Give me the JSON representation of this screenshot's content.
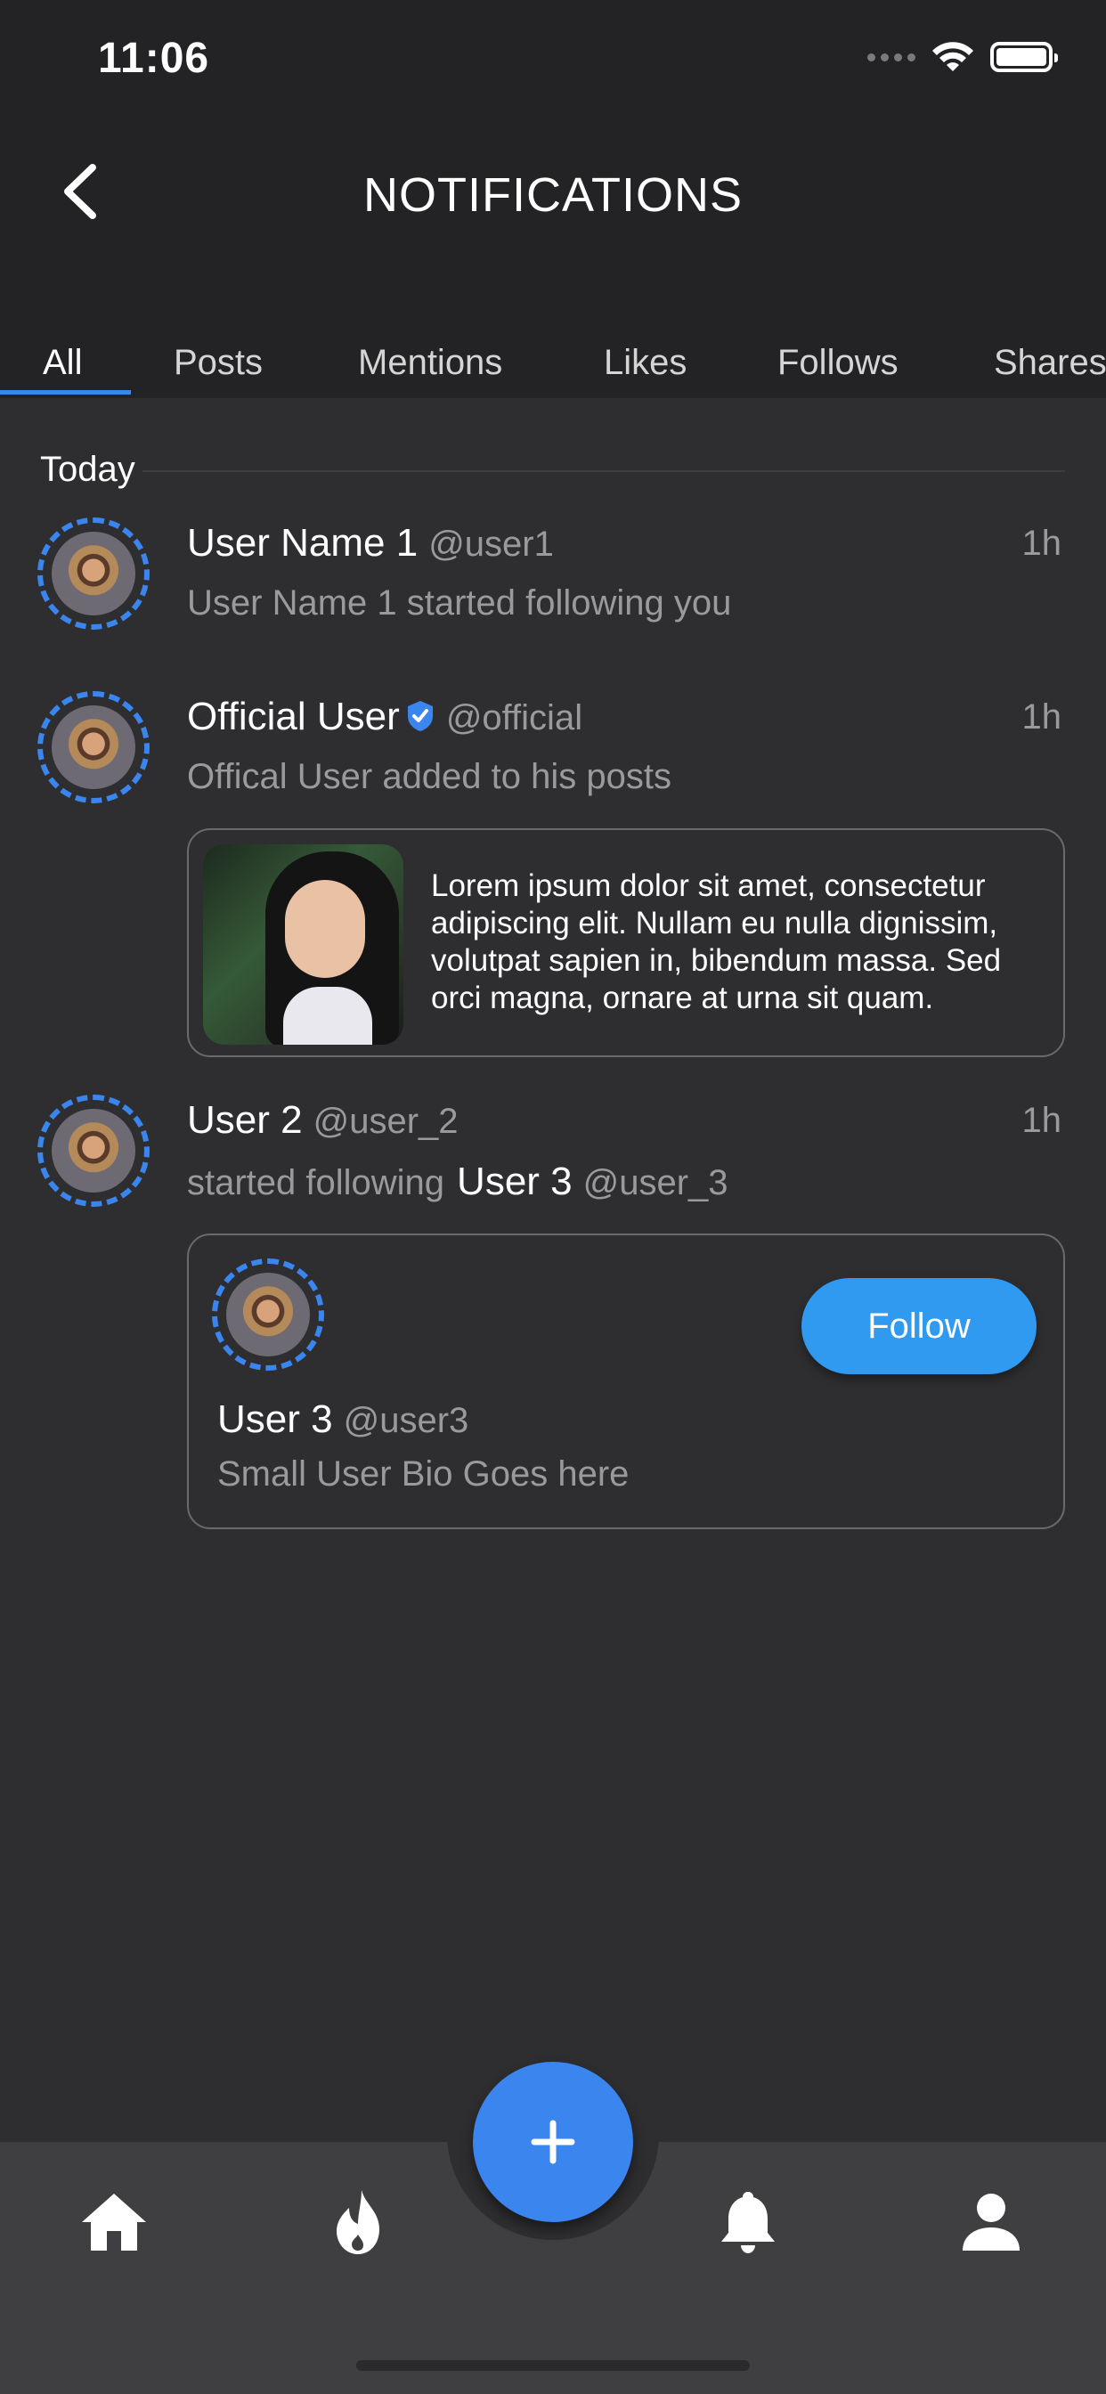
{
  "status_bar": {
    "time": "11:06"
  },
  "header": {
    "title": "NOTIFICATIONS"
  },
  "tabs": [
    {
      "label": "All",
      "active": true
    },
    {
      "label": "Posts"
    },
    {
      "label": "Mentions"
    },
    {
      "label": "Likes"
    },
    {
      "label": "Follows"
    },
    {
      "label": "Shares"
    }
  ],
  "section": {
    "label": "Today"
  },
  "notifications": [
    {
      "name": "User Name 1",
      "handle": "@user1",
      "time": "1h",
      "text": "User Name 1 started following you"
    },
    {
      "name": "Official User",
      "handle": "@official",
      "time": "1h",
      "text": "Offical User added to his posts",
      "verified": true,
      "post": {
        "text": "Lorem ipsum dolor sit amet, consectetur adipiscing elit. Nullam eu nulla dignissim, volutpat sapien in, bibendum massa. Sed orci magna, ornare at urna sit quam."
      }
    },
    {
      "name": "User 2",
      "handle": "@user_2",
      "time": "1h",
      "text": "started following",
      "target_name": "User 3",
      "target_handle": "@user_3",
      "user_card": {
        "name": "User 3",
        "handle": "@user3",
        "bio": "Small User Bio Goes here",
        "button": "Follow"
      }
    }
  ],
  "colors": {
    "accent": "#3a85ee",
    "follow_button": "#2f9af0",
    "background": "#2e2e30",
    "header": "#232325"
  },
  "bottom_nav": {
    "items": [
      "home-icon",
      "flame-icon",
      "add-icon",
      "bell-icon",
      "profile-icon"
    ]
  }
}
